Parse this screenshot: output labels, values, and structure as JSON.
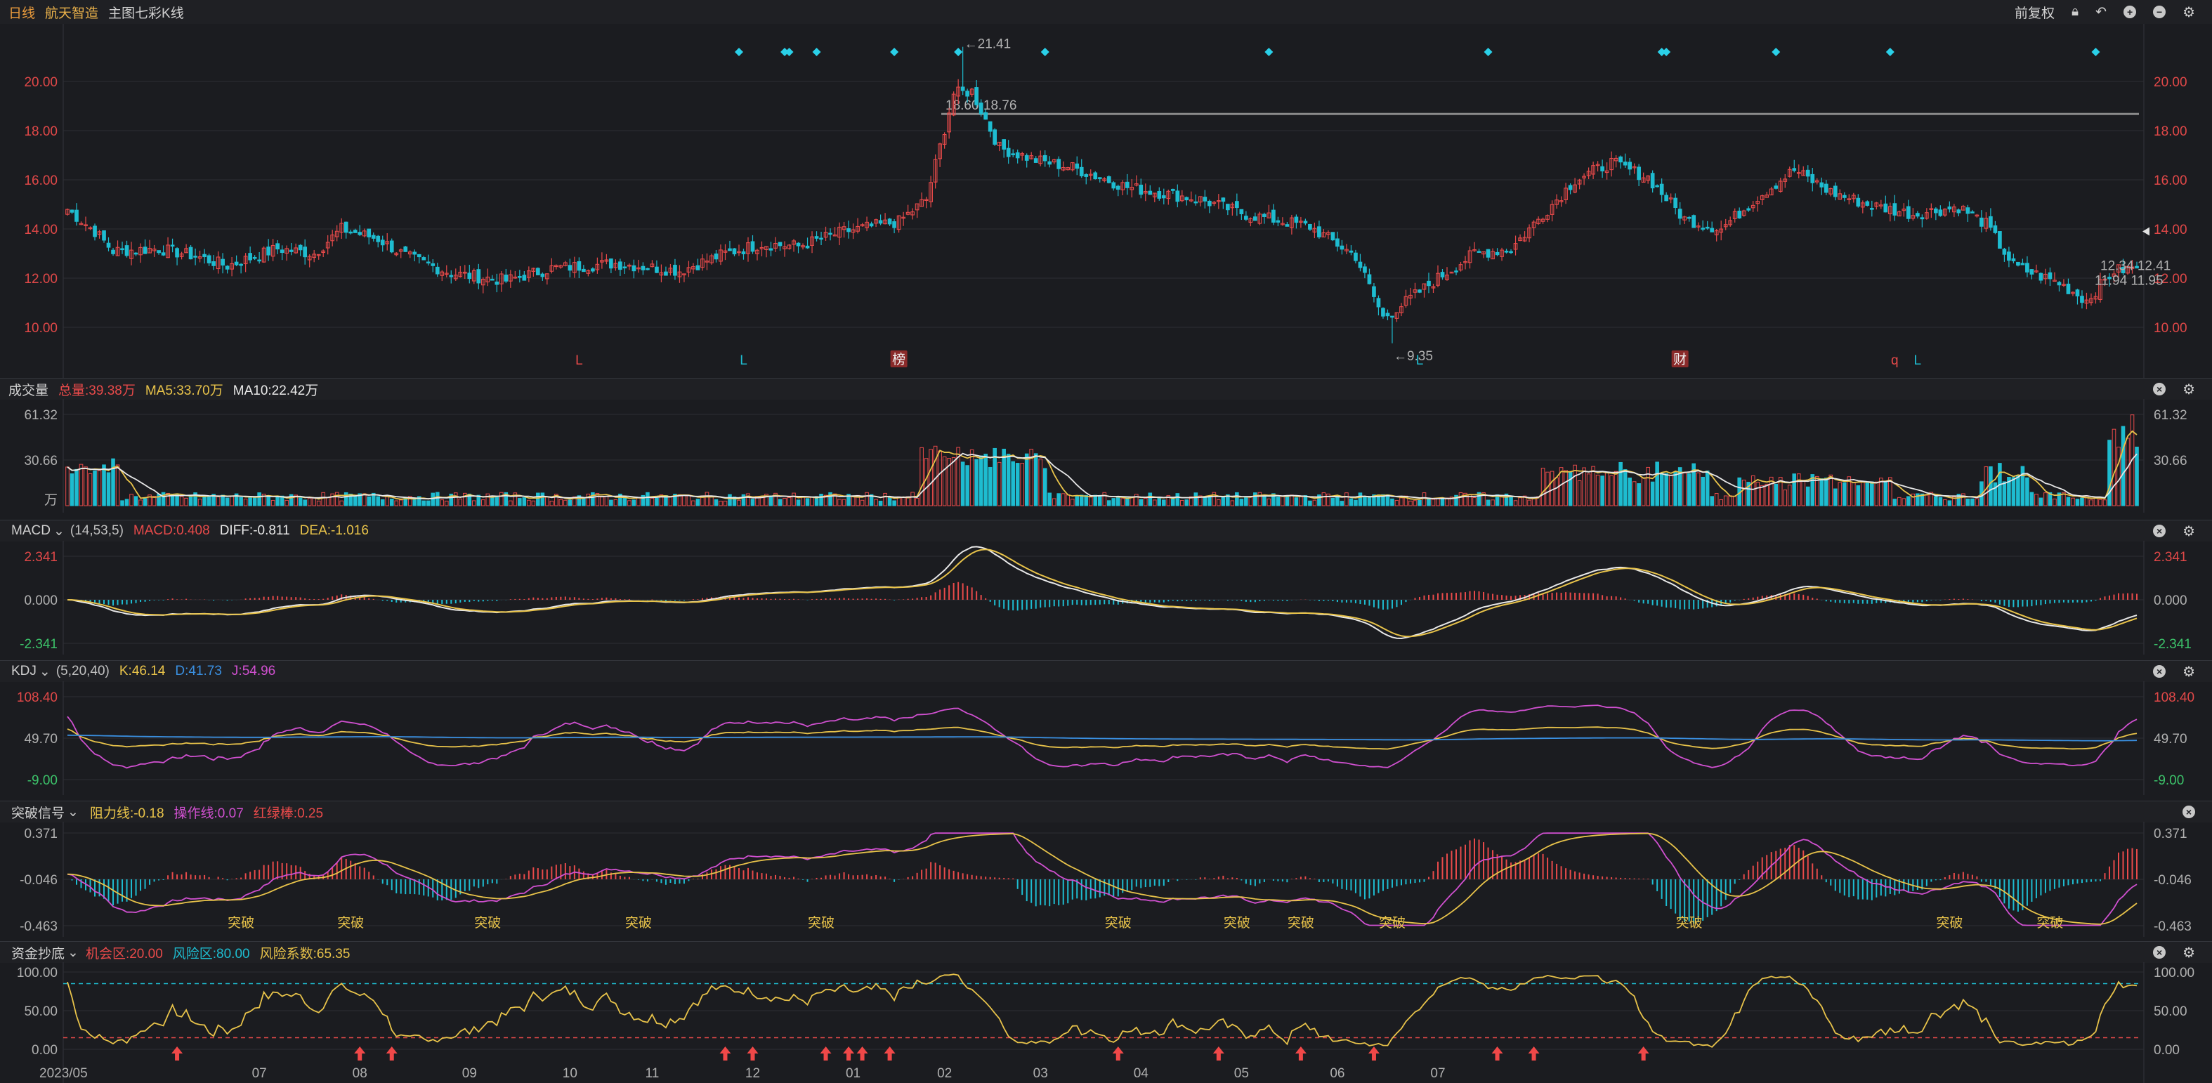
{
  "header": {
    "period": "日线",
    "stock_name": "航天智造",
    "indicator": "主图七彩K线",
    "restore": "前复权"
  },
  "colors": {
    "up": "#e84a4a",
    "down": "#1ebcd0",
    "bg": "#1b1c20",
    "grid": "#2c2e33",
    "yellow": "#e8c34a",
    "white": "#e8e8e8",
    "magenta": "#d050d0",
    "blue": "#3a8fe0"
  },
  "main_chart": {
    "y_ticks": [
      "20.00",
      "18.00",
      "16.00",
      "14.00",
      "12.00",
      "10.00"
    ],
    "annotations": {
      "high": "←21.41",
      "low": "←9.35",
      "band": "18.60-18.76",
      "last": "12.34 12.41",
      "last2": "11.94 11.95"
    },
    "signal_labels": [
      {
        "text": "L",
        "color": "red"
      },
      {
        "text": "L",
        "color": "cyan"
      },
      {
        "text": "榜",
        "color": "box"
      },
      {
        "text": "L",
        "color": "cyan"
      },
      {
        "text": "财",
        "color": "box"
      },
      {
        "text": "q",
        "color": "red"
      },
      {
        "text": "L",
        "color": "cyan"
      }
    ],
    "x_labels": [
      "2023/05",
      "07",
      "08",
      "09",
      "10",
      "11",
      "12",
      "01",
      "02",
      "03",
      "04",
      "05",
      "06",
      "07"
    ]
  },
  "volume": {
    "title": "成交量",
    "total": "总量:39.38万",
    "ma5": "MA5:33.70万",
    "ma10": "MA10:22.42万",
    "y_ticks": [
      "61.32",
      "30.66"
    ],
    "unit": "万"
  },
  "macd": {
    "title": "MACD",
    "params": "(14,53,5)",
    "macd": "MACD:0.408",
    "diff": "DIFF:-0.811",
    "dea": "DEA:-1.016",
    "y_ticks": [
      "2.341",
      "0.000",
      "-2.341"
    ]
  },
  "kdj": {
    "title": "KDJ",
    "params": "(5,20,40)",
    "k": "K:46.14",
    "d": "D:41.73",
    "j": "J:54.96",
    "y_ticks": [
      "108.40",
      "49.70",
      "-9.00"
    ]
  },
  "breakout": {
    "title": "突破信号",
    "resist": "阻力线:-0.18",
    "operate": "操作线:0.07",
    "redgreen": "红绿棒:0.25",
    "y_ticks": [
      "0.371",
      "-0.046",
      "-0.463"
    ],
    "signal": "突破"
  },
  "fund": {
    "title": "资金抄底",
    "opportunity": "机会区:20.00",
    "risk": "风险区:80.00",
    "coef": "风险系数:65.35",
    "y_ticks": [
      "100.00",
      "50.00",
      "0.00"
    ]
  },
  "chart_data": {
    "type": "candlestick",
    "title": "航天智造 日线",
    "ylim": [
      9.0,
      21.5
    ],
    "high": 21.41,
    "low": 9.35,
    "last_close": 12.41,
    "x_labels": [
      "2023/05",
      "07",
      "08",
      "09",
      "10",
      "11",
      "12",
      "01",
      "02",
      "03",
      "04",
      "05",
      "06",
      "07"
    ],
    "close_anchors": [
      [
        0,
        14.8
      ],
      [
        6,
        13.9
      ],
      [
        10,
        13.1
      ],
      [
        20,
        13.2
      ],
      [
        28,
        12.9
      ],
      [
        35,
        12.5
      ],
      [
        46,
        13.2
      ],
      [
        54,
        13.0
      ],
      [
        60,
        14.0
      ],
      [
        68,
        13.6
      ],
      [
        74,
        12.9
      ],
      [
        84,
        12.2
      ],
      [
        96,
        11.9
      ],
      [
        106,
        12.4
      ],
      [
        120,
        12.6
      ],
      [
        134,
        12.3
      ],
      [
        144,
        13.0
      ],
      [
        152,
        13.4
      ],
      [
        160,
        13.3
      ],
      [
        170,
        13.9
      ],
      [
        182,
        14.3
      ],
      [
        188,
        15.2
      ],
      [
        194,
        19.5
      ],
      [
        198,
        19.6
      ],
      [
        204,
        17.3
      ],
      [
        212,
        16.8
      ],
      [
        220,
        16.5
      ],
      [
        232,
        15.7
      ],
      [
        248,
        15.2
      ],
      [
        258,
        14.6
      ],
      [
        272,
        14.1
      ],
      [
        282,
        12.9
      ],
      [
        288,
        10.4
      ],
      [
        292,
        10.9
      ],
      [
        300,
        12.0
      ],
      [
        308,
        13.0
      ],
      [
        316,
        13.2
      ],
      [
        322,
        14.4
      ],
      [
        330,
        16.0
      ],
      [
        338,
        16.7
      ],
      [
        346,
        16.1
      ],
      [
        354,
        14.4
      ],
      [
        362,
        14.0
      ],
      [
        370,
        15.3
      ],
      [
        378,
        16.4
      ],
      [
        386,
        15.5
      ],
      [
        394,
        15.0
      ],
      [
        404,
        14.6
      ],
      [
        414,
        14.9
      ],
      [
        420,
        14.2
      ],
      [
        426,
        12.5
      ],
      [
        436,
        11.8
      ],
      [
        442,
        11.1
      ],
      [
        448,
        12.3
      ],
      [
        453,
        12.41
      ]
    ],
    "volume": {
      "ylim": [
        0,
        61.32
      ],
      "unit": "万",
      "total": 39.38,
      "ma5": 33.7,
      "ma10": 22.42
    },
    "macd": {
      "ylim": [
        -2.341,
        2.341
      ],
      "macd": 0.408,
      "diff": -0.811,
      "dea": -1.016
    },
    "kdj": {
      "ylim": [
        -9.0,
        108.4
      ],
      "k": 46.14,
      "d": 41.73,
      "j": 54.96
    },
    "breakout": {
      "ylim": [
        -0.463,
        0.371
      ],
      "resist": -0.18,
      "operate": 0.07,
      "redgreen": 0.25
    },
    "fund": {
      "ylim": [
        0,
        100
      ],
      "opportunity": 20.0,
      "risk": 80.0,
      "coef": 65.35
    }
  }
}
